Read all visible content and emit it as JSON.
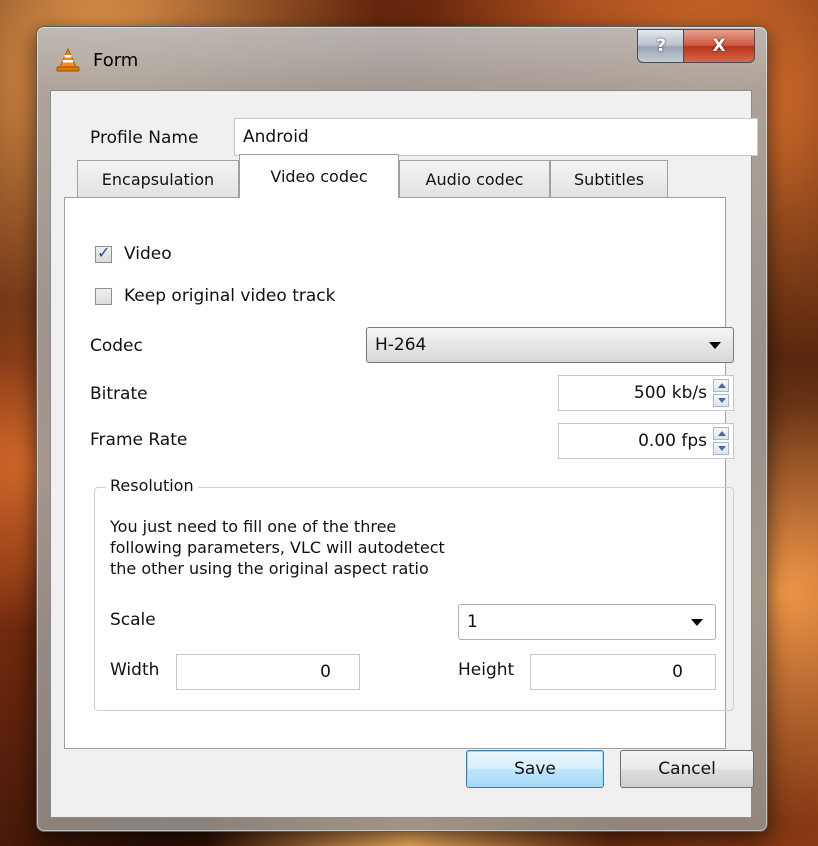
{
  "window": {
    "title": "Form",
    "help_glyph": "?",
    "close_glyph": "X"
  },
  "profile": {
    "label": "Profile Name",
    "value": "Android"
  },
  "tabs": [
    {
      "label": "Encapsulation",
      "active": false
    },
    {
      "label": "Video codec",
      "active": true
    },
    {
      "label": "Audio codec",
      "active": false
    },
    {
      "label": "Subtitles",
      "active": false
    }
  ],
  "video": {
    "video_checkbox": {
      "label": "Video",
      "checked": true
    },
    "keep_original": {
      "label": "Keep original video track",
      "checked": false
    },
    "codec": {
      "label": "Codec",
      "value": "H-264"
    },
    "bitrate": {
      "label": "Bitrate",
      "value": "500 kb/s"
    },
    "frame_rate": {
      "label": "Frame Rate",
      "value": "0.00 fps"
    }
  },
  "resolution": {
    "title": "Resolution",
    "info_lines": [
      "You just need to fill one of the three",
      "following parameters, VLC will autodetect",
      "the other using the original aspect ratio"
    ],
    "scale": {
      "label": "Scale",
      "value": "1"
    },
    "width": {
      "label": "Width",
      "value": "0"
    },
    "height": {
      "label": "Height",
      "value": "0"
    }
  },
  "buttons": {
    "save": "Save",
    "cancel": "Cancel"
  },
  "colors": {
    "check_mark": "#2b4a9a",
    "close_button": "#c8442a",
    "default_button_border": "#3c7fb1"
  }
}
